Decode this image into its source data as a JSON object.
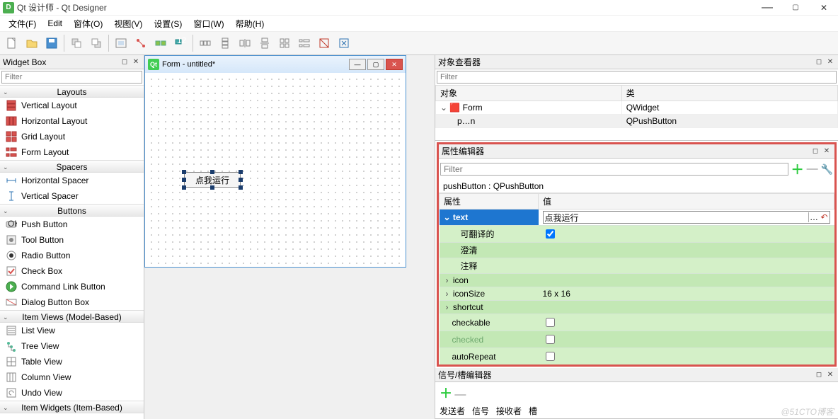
{
  "window": {
    "title": "Qt 设计师 - Qt Designer"
  },
  "menu": {
    "file": "文件(F)",
    "edit": "Edit",
    "forms": "窗体(O)",
    "view": "视图(V)",
    "settings": "设置(S)",
    "window": "窗口(W)",
    "help": "帮助(H)"
  },
  "widgetbox": {
    "title": "Widget Box",
    "filter_ph": "Filter",
    "sections": {
      "layouts": "Layouts",
      "spacers": "Spacers",
      "buttons": "Buttons",
      "item_views": "Item Views (Model-Based)",
      "item_widgets": "Item Widgets (Item-Based)"
    },
    "items": {
      "vlayout": "Vertical Layout",
      "hlayout": "Horizontal Layout",
      "grid": "Grid Layout",
      "form": "Form Layout",
      "hspacer": "Horizontal Spacer",
      "vspacer": "Vertical Spacer",
      "pushbtn": "Push Button",
      "toolbtn": "Tool Button",
      "radiobtn": "Radio Button",
      "checkbox": "Check Box",
      "cmdlink": "Command Link Button",
      "dlgbox": "Dialog Button Box",
      "listview": "List View",
      "treeview": "Tree View",
      "tableview": "Table View",
      "columnview": "Column View",
      "undoview": "Undo View"
    }
  },
  "form": {
    "wintitle": "Form - untitled*",
    "button_text": "点我运行"
  },
  "objinspector": {
    "title": "对象查看器",
    "filter_ph": "Filter",
    "col_obj": "对象",
    "col_cls": "类",
    "rows": [
      {
        "obj": "Form",
        "cls": "QWidget"
      },
      {
        "obj": "p…n",
        "cls": "QPushButton"
      }
    ]
  },
  "propeditor": {
    "title": "属性编辑器",
    "filter_ph": "Filter",
    "objline": "pushButton : QPushButton",
    "col_prop": "属性",
    "col_val": "值",
    "props": {
      "text": "text",
      "text_val": "点我运行",
      "translatable": "可翻译的",
      "clear": "澄清",
      "note": "注释",
      "icon": "icon",
      "iconSize": "iconSize",
      "iconSize_val": "16 x 16",
      "shortcut": "shortcut",
      "checkable": "checkable",
      "checked": "checked",
      "autoRepeat": "autoRepeat"
    }
  },
  "sigslot": {
    "title": "信号/槽编辑器",
    "sender": "发送者",
    "signal": "信号",
    "receiver": "接收者",
    "slot": "槽"
  },
  "watermark": "@51CTO博客"
}
